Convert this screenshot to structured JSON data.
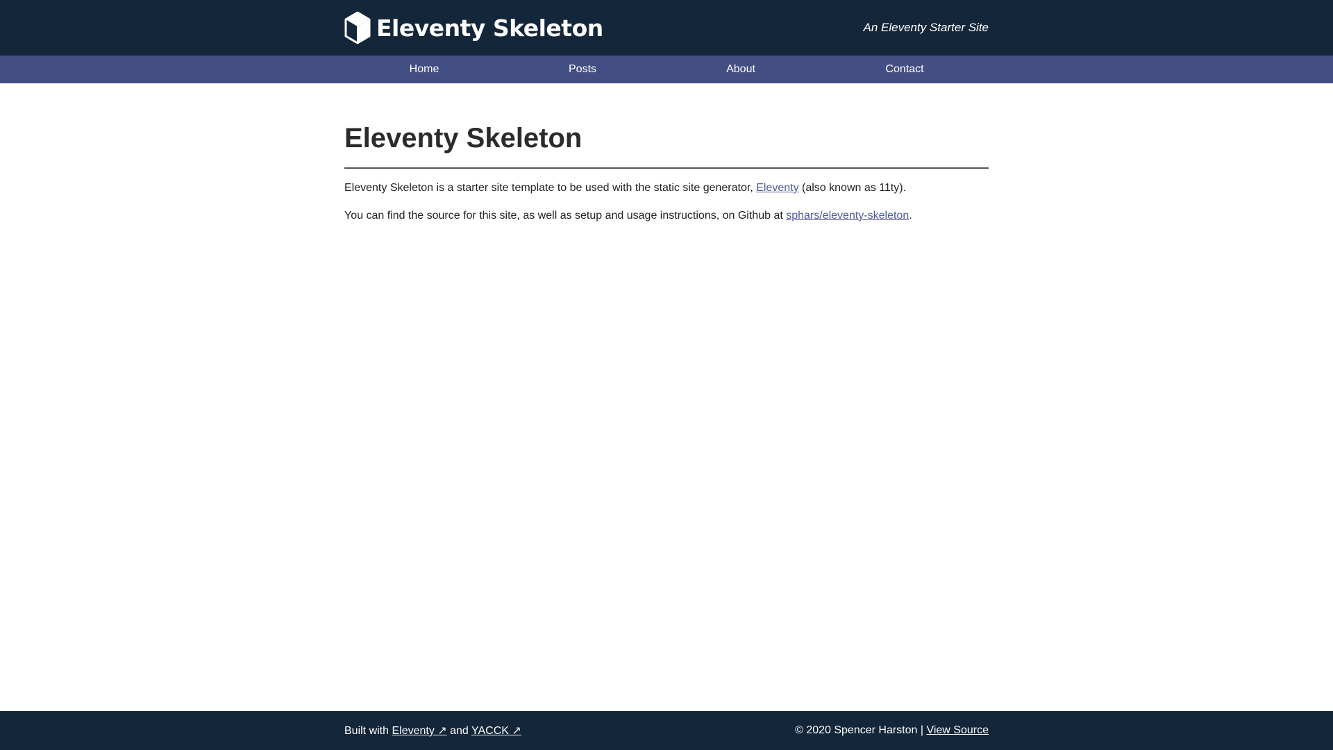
{
  "header": {
    "brand_title": "Eleventy Skeleton",
    "logo_icon": "cube-icon",
    "tagline": "An Eleventy Starter Site"
  },
  "nav": {
    "items": [
      {
        "label": "Home"
      },
      {
        "label": "Posts"
      },
      {
        "label": "About"
      },
      {
        "label": "Contact"
      }
    ]
  },
  "main": {
    "title": "Eleventy Skeleton",
    "p1": {
      "before": "Eleventy Skeleton is a starter site template to be used with the static site generator, ",
      "link": "Eleventy",
      "after": " (also known as 11ty)."
    },
    "p2": {
      "before": "You can find the source for this site, as well as setup and usage instructions, on Github at ",
      "link": "sphars/eleventy-skeleton",
      "after": "."
    }
  },
  "footer": {
    "built_with": "Built with ",
    "link1": "Eleventy ↗",
    "and": " and ",
    "link2": "YACCK ↗",
    "copyright": "© 2020 Spencer Harston | ",
    "view_source": "View Source"
  },
  "colors": {
    "header_bg": "#13263a",
    "nav_bg": "#434f84",
    "link": "#4a5a9c"
  }
}
